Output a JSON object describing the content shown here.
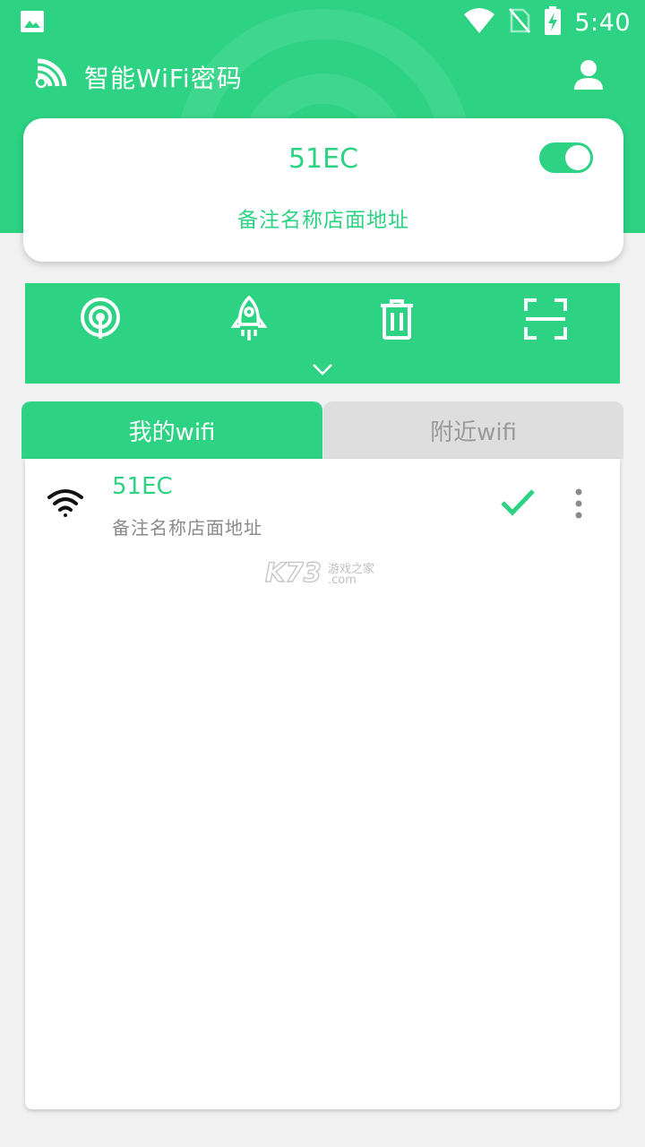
{
  "status_bar": {
    "time": "5:40",
    "icons": [
      "image-icon",
      "wifi-signal-icon",
      "no-sim-icon",
      "battery-charging-icon"
    ]
  },
  "app_bar": {
    "title": "智能WiFi密码",
    "logo_icon": "wifi-key-logo-icon",
    "user_icon": "user-icon"
  },
  "current_network": {
    "ssid": "51EC",
    "note": "备注名称店面地址",
    "enabled": true
  },
  "toolbar": {
    "tools": [
      {
        "icon": "hotspot-icon"
      },
      {
        "icon": "rocket-icon"
      },
      {
        "icon": "trash-icon"
      },
      {
        "icon": "scan-icon"
      }
    ],
    "expand_icon": "chevron-down-icon"
  },
  "tabs": {
    "mine": "我的wifi",
    "nearby": "附近wifi"
  },
  "wifi_list": [
    {
      "ssid": "51EC",
      "note": "备注名称店面地址",
      "connected": true
    }
  ],
  "watermark": {
    "brand": "K73",
    "line1": "游戏之家",
    "line2": ".com"
  },
  "colors": {
    "primary": "#2dd283",
    "background": "#f1f1f1",
    "tab_inactive": "#dedede"
  }
}
